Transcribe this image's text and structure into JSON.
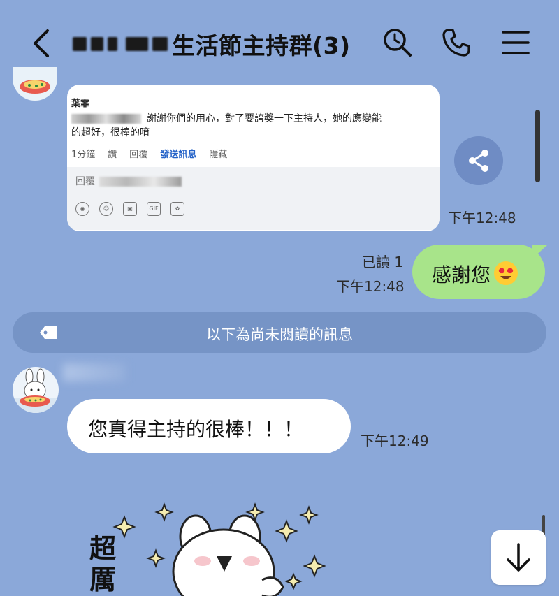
{
  "header": {
    "title": "生活節主持群(3)",
    "back_icon": "back-chevron-icon",
    "search_icon": "search-icon",
    "call_icon": "phone-icon",
    "menu_icon": "menu-icon"
  },
  "messages": {
    "screenshot_card": {
      "name": "葉霏",
      "comment": "謝謝你們的用心，對了要誇獎一下主持人，她的應變能",
      "comment_line2": "的超好，很棒的唷",
      "actions": [
        "1分鐘",
        "讚",
        "回覆",
        "發送訊息",
        "隱藏"
      ],
      "reply_placeholder": "回覆"
    },
    "card_time": "下午12:48",
    "my_message": {
      "text": "感謝您",
      "read_label": "已讀 1",
      "time": "下午12:48"
    },
    "unread_divider": "以下為尚未閱讀的訊息",
    "incoming_message": {
      "text": "您真得主持的很棒！！！",
      "time": "下午12:49"
    },
    "sticker_text": "超厲"
  },
  "colors": {
    "chat_background": "#8ba8d9",
    "my_bubble": "#a8e48a",
    "their_bubble": "#ffffff",
    "link_blue": "#2563c8"
  }
}
